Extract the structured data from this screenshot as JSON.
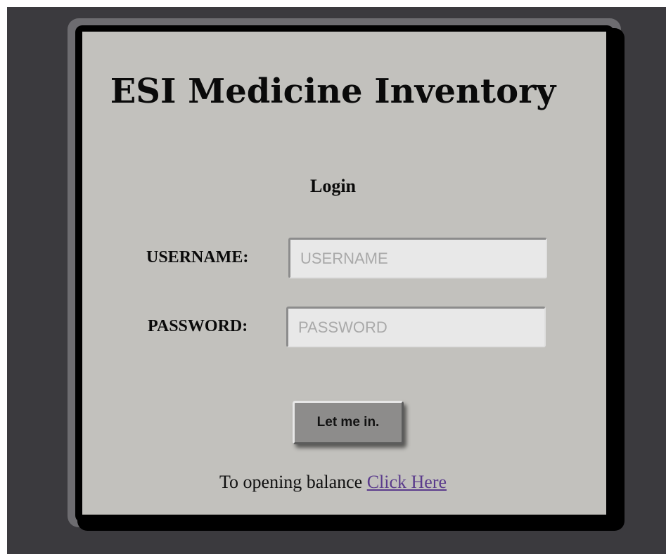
{
  "app": {
    "title": "ESI Medicine Inventory",
    "subtitle": "Login"
  },
  "form": {
    "username": {
      "label": "USERNAME:",
      "placeholder": "USERNAME",
      "value": ""
    },
    "password": {
      "label": "PASSWORD:",
      "placeholder": "PASSWORD",
      "value": ""
    },
    "submit_label": "Let me in."
  },
  "footer": {
    "text": "To opening balance",
    "link_label": "Click Here"
  },
  "colors": {
    "background": "#3b3a3e",
    "panel": "#c2c1bd",
    "input": "#e8e8e8",
    "button": "#8d8c8b",
    "link": "#5a3b8c"
  }
}
